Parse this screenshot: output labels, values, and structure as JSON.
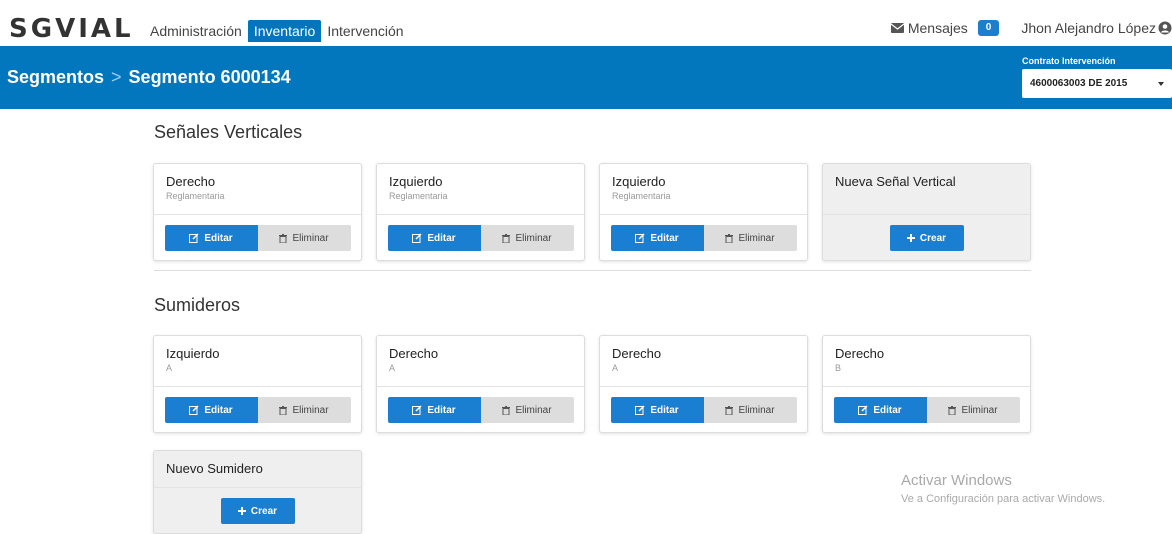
{
  "brand": "SGVIAL",
  "nav": [
    "Administración",
    "Inventario",
    "Intervención"
  ],
  "messages": {
    "label": "Mensajes",
    "count": "0"
  },
  "user": "Jhon Alejandro López",
  "breadcrumb": {
    "parent": "Segmentos",
    "separator": ">",
    "current": "Segmento 6000134"
  },
  "contract": {
    "label": "Contrato Intervención",
    "value": "4600063003 DE 2015"
  },
  "buttons": {
    "edit": "Editar",
    "delete": "Eliminar",
    "create": "Crear"
  },
  "senales": {
    "title": "Señales Verticales",
    "cards": [
      {
        "title": "Derecho",
        "sub": "Reglamentaria"
      },
      {
        "title": "Izquierdo",
        "sub": "Reglamentaria"
      },
      {
        "title": "Izquierdo",
        "sub": "Reglamentaria"
      }
    ],
    "new_title": "Nueva Señal Vertical"
  },
  "sumideros": {
    "title": "Sumideros",
    "cards": [
      {
        "title": "Izquierdo",
        "sub": "A"
      },
      {
        "title": "Derecho",
        "sub": "A"
      },
      {
        "title": "Derecho",
        "sub": "A"
      },
      {
        "title": "Derecho",
        "sub": "B"
      }
    ],
    "new_title": "Nuevo Sumidero"
  },
  "watermark": {
    "line1": "Activar Windows",
    "line2": "Ve a Configuración para activar Windows."
  }
}
